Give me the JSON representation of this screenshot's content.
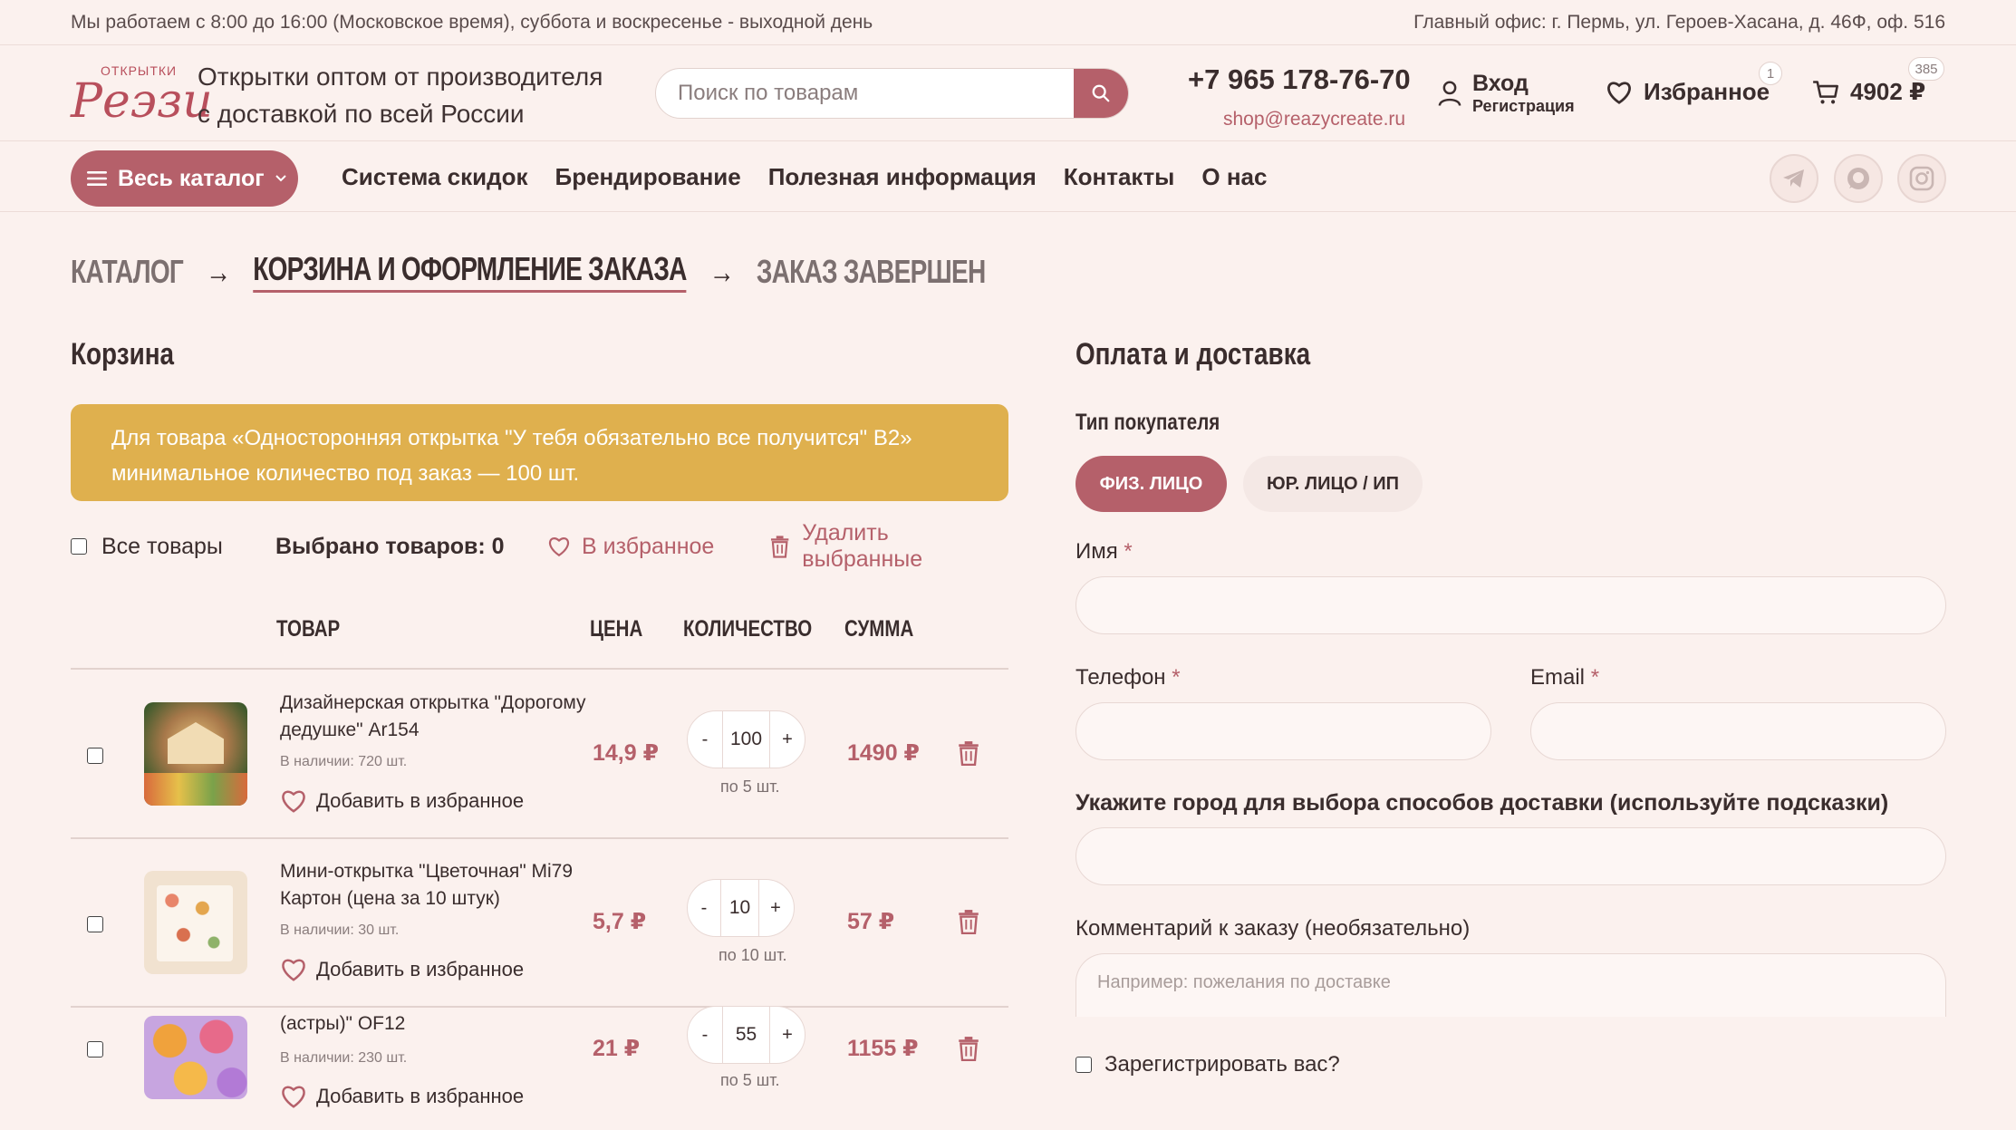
{
  "topbar": {
    "hours": "Мы работаем с 8:00 до 16:00 (Московское время), суббота и воскресенье - выходной день",
    "office": "Главный офис: г. Пермь, ул. Героев-Хасана, д. 46Ф, оф. 516"
  },
  "header": {
    "logo_small": "ОТКРЫТКИ",
    "logo_big": "Реэзи",
    "tagline": "Открытки оптом от производителя с доставкой по всей России",
    "search_placeholder": "Поиск по товарам",
    "phone": "+7 965 178-76-70",
    "email": "shop@reazycreate.ru",
    "login": "Вход",
    "register": "Регистрация",
    "favorites": "Избранное",
    "favorites_count": "1",
    "cart_total": "4902 ₽",
    "cart_count": "385"
  },
  "nav": {
    "catalog": "Весь каталог",
    "links": [
      "Система скидок",
      "Брендирование",
      "Полезная информация",
      "Контакты",
      "О нас"
    ]
  },
  "steps": {
    "step1": "КАТАЛОГ",
    "step2": "КОРЗИНА И ОФОРМЛЕНИЕ ЗАКАЗА",
    "step3": "ЗАКАЗ ЗАВЕРШЕН",
    "arrow": "→"
  },
  "cart": {
    "title": "Корзина",
    "notice": "Для товара «Односторонняя открытка \"У тебя обязательно все получится\" B2» минимальное количество под заказ — 100 шт.",
    "all_items": "Все товары",
    "selected": "Выбрано товаров: 0",
    "to_favorites": "В избранное",
    "delete_selected": "Удалить выбранные",
    "columns": {
      "product": "ТОВАР",
      "price": "ЦЕНА",
      "qty": "КОЛИЧЕСТВО",
      "sum": "СУММА"
    },
    "add_fav": "Добавить в избранное",
    "items": [
      {
        "name": "Дизайнерская открытка \"Дорогому дедушке\" Ar154",
        "stock": "В наличии: 720 шт.",
        "price": "14,9 ₽",
        "qty": "100",
        "step": "по 5 шт.",
        "sum": "1490 ₽"
      },
      {
        "name": "Мини-открытка \"Цветочная\" Mi79 Картон (цена за 10 штук)",
        "stock": "В наличии: 30 шт.",
        "price": "5,7 ₽",
        "qty": "10",
        "step": "по 10 шт.",
        "sum": "57 ₽"
      },
      {
        "name": "(астры)\" OF12",
        "stock": "В наличии: 230 шт.",
        "price": "21 ₽",
        "qty": "55",
        "step": "по 5 шт.",
        "sum": "1155 ₽"
      }
    ]
  },
  "checkout": {
    "title": "Оплата и доставка",
    "buyer_type": "Тип покупателя",
    "person": "ФИЗ. ЛИЦО",
    "company": "ЮР. ЛИЦО / ИП",
    "name_label": "Имя",
    "phone_label": "Телефон",
    "email_label": "Email",
    "required": "*",
    "city_label": "Укажите город для выбора способов доставки (используйте подсказки)",
    "comment_label": "Комментарий к заказу (необязательно)",
    "comment_placeholder": "Например: пожелания по доставке",
    "register": "Зарегистрировать вас?"
  },
  "colors": {
    "accent": "#b5606a",
    "notice": "#dfb04e",
    "background": "#fbf1ee"
  }
}
